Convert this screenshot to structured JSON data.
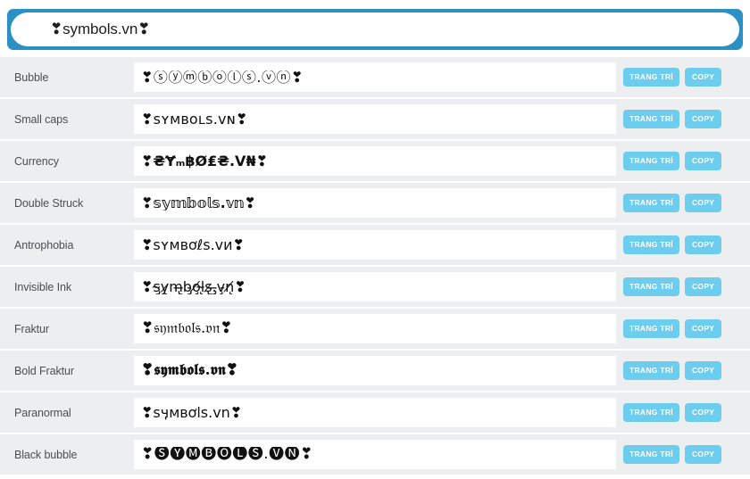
{
  "search": {
    "value": "❣symbols.vn❣",
    "placeholder": "symbols.vn",
    "accent_color": "#2b90c4"
  },
  "buttons": {
    "decorate_label": "TRANG TRÍ",
    "copy_label": "COPY",
    "color": "#6ccdee"
  },
  "rows": [
    {
      "label": "Bubble",
      "text": "❣ⓢⓨⓜⓑⓞⓛⓢ.ⓥⓝ❣",
      "style": "st-bubble"
    },
    {
      "label": "Small caps",
      "text": "❣ꜱʏᴍʙᴏʟꜱ.ᴠɴ❣",
      "style": "st-smallcaps"
    },
    {
      "label": "Currency",
      "text": "❣₴Ɏₘ฿Ø₤₴.V₦❣",
      "style": "st-currency"
    },
    {
      "label": "Double Struck",
      "text": "❣𝕤𝕪𝕞𝕓𝕠𝕝𝕤.𝕧𝕟❣",
      "style": "st-dstruck"
    },
    {
      "label": "Antrophobia",
      "text": "❣ꜱʏᴍʙơℓꜱ.vи❣",
      "style": "st-antro"
    },
    {
      "label": "Invisible Ink",
      "text": "❣s̴̡y̷̨m̶̢b̵̡o̸̧l̴̨s̷̢.̶̡v̵̧n̸̨❣",
      "style": "st-invisible"
    },
    {
      "label": "Fraktur",
      "text": "❣𝔰𝔶𝔪𝔟𝔬𝔩𝔰.𝔳𝔫❣",
      "style": "st-fraktur"
    },
    {
      "label": "Bold Fraktur",
      "text": "❣𝖘𝖞𝖒𝖇𝖔𝖑𝖘.𝖛𝖓❣",
      "style": "st-boldfraktur"
    },
    {
      "label": "Paranormal",
      "text": "❣ꜱӌᴍʙơls.vn❣",
      "style": "st-paranormal"
    },
    {
      "label": "Black bubble",
      "text": "❣🅢🅨🅜🅑🅞🅛🅢.🅥🅝❣",
      "style": "st-blackbub"
    }
  ]
}
